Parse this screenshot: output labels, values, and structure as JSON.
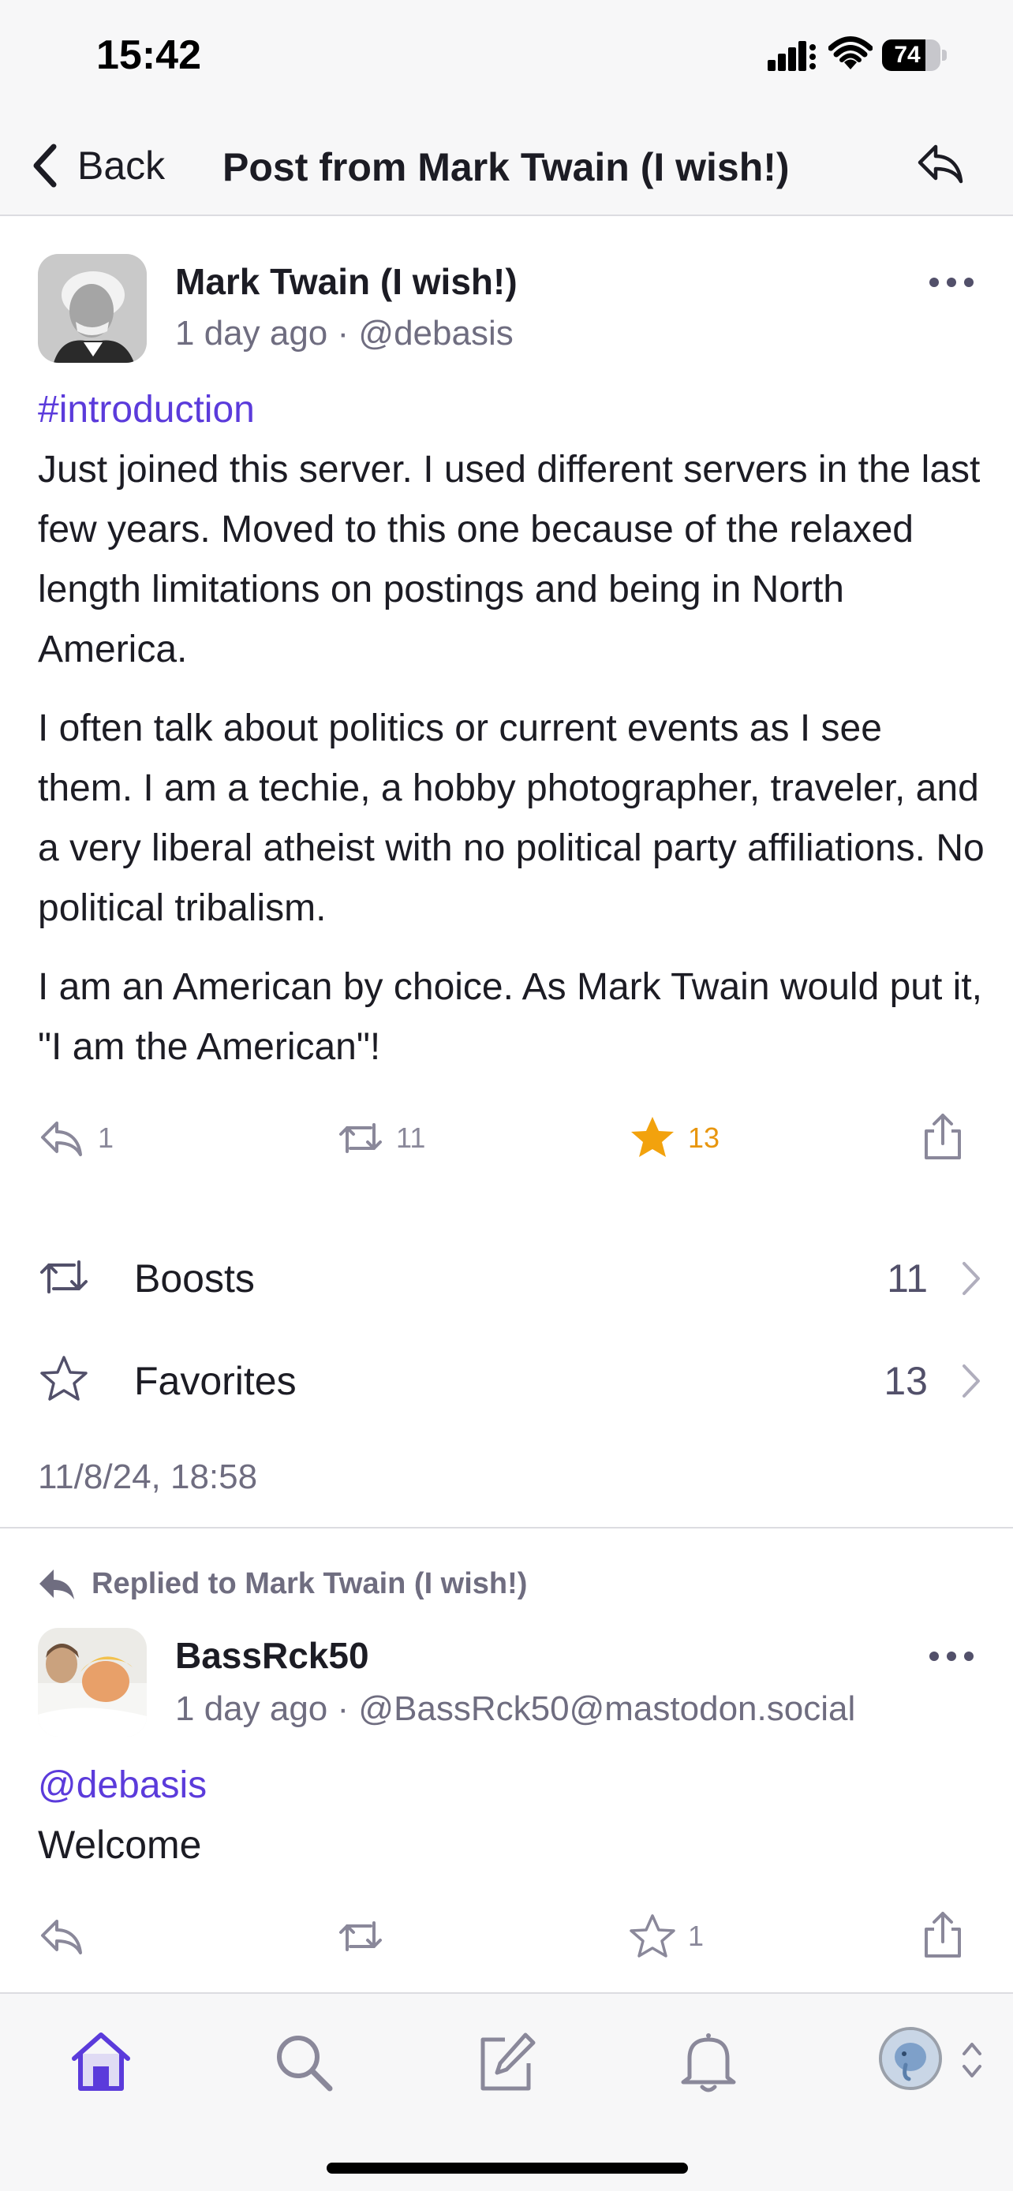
{
  "status_bar": {
    "time": "15:42",
    "battery_level": "74",
    "battery_fraction": 0.74
  },
  "nav": {
    "back_label": "Back",
    "title": "Post from Mark Twain (I wish!)"
  },
  "post": {
    "author": "Mark Twain (I wish!)",
    "time_ago": "1 day ago",
    "handle": "@debasis",
    "hashtag": "#introduction",
    "paragraphs": [
      "Just joined this server. I used different servers in the last few years. Moved to this one because of the relaxed length limitations on postings and being in North America.",
      "I often talk about politics or current events as I see them. I am a techie, a hobby photographer, traveler, and a very liberal atheist with no political party affiliations. No political tribalism.",
      "I am an American by choice. As Mark Twain would put it, \"I am the American\"!"
    ],
    "replies_count": "1",
    "boosts_count": "11",
    "favorites_count": "13",
    "favorited": true,
    "stats": [
      {
        "label": "Boosts",
        "count": "11"
      },
      {
        "label": "Favorites",
        "count": "13"
      }
    ],
    "date": "11/8/24, 18:58"
  },
  "reply": {
    "context": "Replied to Mark Twain (I wish!)",
    "author": "BassRck50",
    "time_ago": "1 day ago",
    "handle": "@BassRck50@mastodon.social",
    "mention": "@debasis",
    "body": "Welcome",
    "favorites_count": "1"
  },
  "tabs": [
    {
      "name": "home",
      "icon": "home-icon",
      "active": true
    },
    {
      "name": "search",
      "icon": "search-icon",
      "active": false
    },
    {
      "name": "compose",
      "icon": "compose-icon",
      "active": false
    },
    {
      "name": "notifications",
      "icon": "bell-icon",
      "active": false
    },
    {
      "name": "profile",
      "icon": "avatar",
      "active": false
    }
  ],
  "colors": {
    "accent": "#5b3bdb",
    "favorite": "#f2a20d",
    "secondary_text": "#6f6d80",
    "bar_background": "#f7f7f8"
  }
}
